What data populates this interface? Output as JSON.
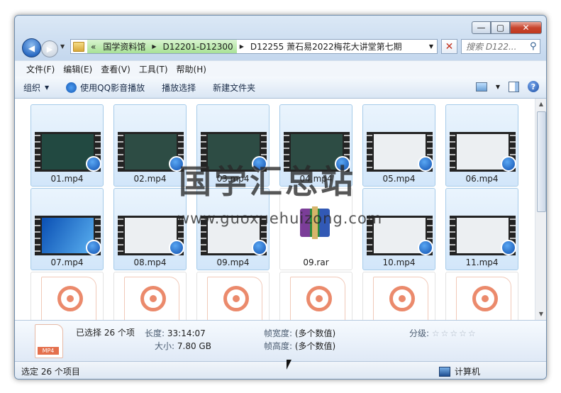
{
  "window": {
    "caption": {
      "minimize": "—",
      "maximize": "▢",
      "close": "✕"
    }
  },
  "address": {
    "prefix": "«",
    "crumbs": [
      "国学资料馆",
      "D12201-D12300",
      "D12255 萧石易2022梅花大讲堂第七期"
    ]
  },
  "search": {
    "placeholder": "搜索 D122..."
  },
  "menu": [
    "文件(F)",
    "编辑(E)",
    "查看(V)",
    "工具(T)",
    "帮助(H)"
  ],
  "toolbar": {
    "organize": "组织",
    "play_qq": "使用QQ影音播放",
    "play_selected": "播放选择",
    "new_folder": "新建文件夹"
  },
  "files": [
    {
      "name": "01.mp4",
      "kind": "video",
      "screen": "red"
    },
    {
      "name": "02.mp4",
      "kind": "video",
      "screen": "green"
    },
    {
      "name": "03.mp4",
      "kind": "video",
      "screen": "green"
    },
    {
      "name": "04.mp4",
      "kind": "video",
      "screen": "green"
    },
    {
      "name": "05.mp4",
      "kind": "video",
      "screen": "white"
    },
    {
      "name": "06.mp4",
      "kind": "video",
      "screen": "white"
    },
    {
      "name": "07.mp4",
      "kind": "video",
      "screen": "blue"
    },
    {
      "name": "08.mp4",
      "kind": "video",
      "screen": "white"
    },
    {
      "name": "09.mp4",
      "kind": "video",
      "screen": "white"
    },
    {
      "name": "09.rar",
      "kind": "rar"
    },
    {
      "name": "10.mp4",
      "kind": "video",
      "screen": "white"
    },
    {
      "name": "11.mp4",
      "kind": "video",
      "screen": "white"
    },
    {
      "name": "",
      "kind": "doc"
    },
    {
      "name": "",
      "kind": "doc"
    },
    {
      "name": "",
      "kind": "doc"
    },
    {
      "name": "",
      "kind": "doc"
    },
    {
      "name": "",
      "kind": "doc"
    },
    {
      "name": "",
      "kind": "doc"
    }
  ],
  "details": {
    "selected": "已选择 26 个项",
    "length_label": "长度:",
    "length": "33:14:07",
    "size_label": "大小:",
    "size": "7.80 GB",
    "width_label": "帧宽度:",
    "width": "(多个数值)",
    "height_label": "帧高度:",
    "height": "(多个数值)",
    "rating_label": "分级:",
    "rating_stars": "☆☆☆☆☆"
  },
  "status": {
    "left": "选定 26 个项目",
    "right": "计算机"
  },
  "watermark": {
    "title": "国学汇总站",
    "url": "www.guoxuehuizong.com"
  }
}
